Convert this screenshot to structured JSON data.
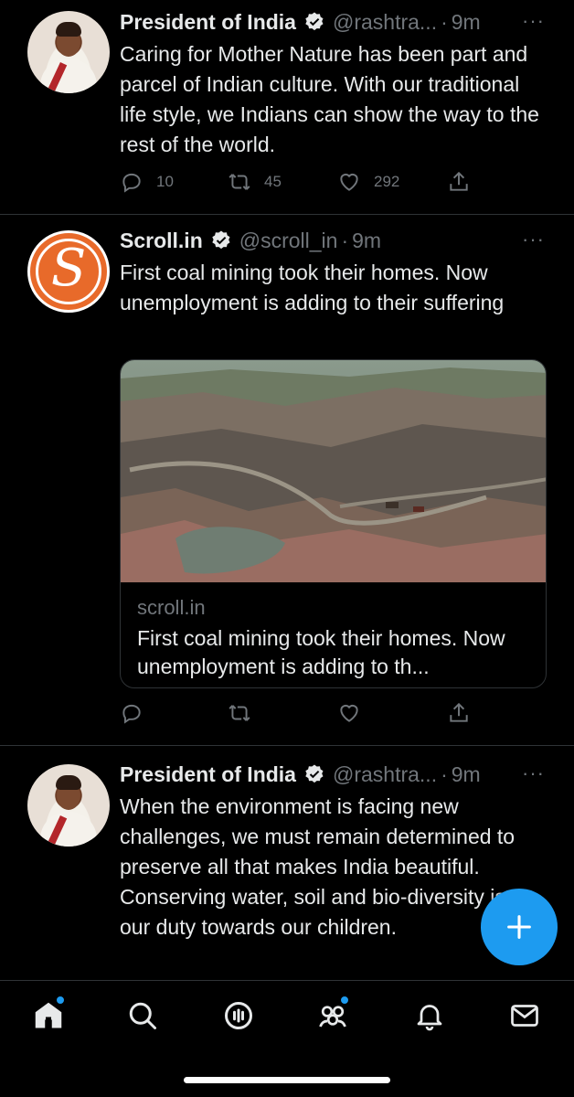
{
  "tweets": [
    {
      "name": "President of India",
      "handle": "@rashtra...",
      "time": "9m",
      "text": "Caring for Mother Nature has been part and parcel of Indian culture. With our traditional life style, we Indians can show the way to the rest of the world.",
      "replies": "10",
      "retweets": "45",
      "likes": "292"
    },
    {
      "name": "Scroll.in",
      "handle": "@scroll_in",
      "time": "9m",
      "text": "First coal mining took their homes. Now unemployment is adding to their suffering",
      "card": {
        "domain": "scroll.in",
        "title": "First coal mining took their homes. Now unemployment is adding to th..."
      }
    },
    {
      "name": "President of India",
      "handle": "@rashtra...",
      "time": "9m",
      "text": "When the environment is facing new challenges, we must remain determined to preserve all that makes India beautiful. Conserving water, soil and bio-diversity is our duty towards our children."
    }
  ],
  "separator": "·",
  "more_glyph": "···",
  "scroll_logo_glyph": "S",
  "colors": {
    "accent": "#1d9bf0",
    "background": "#000000",
    "text": "#e7e9ea",
    "muted": "#71767b",
    "scroll_brand": "#e86a2a"
  },
  "tabbar": {
    "items": [
      "home-icon",
      "search-icon",
      "spaces-icon",
      "communities-icon",
      "notifications-icon",
      "messages-icon"
    ]
  }
}
